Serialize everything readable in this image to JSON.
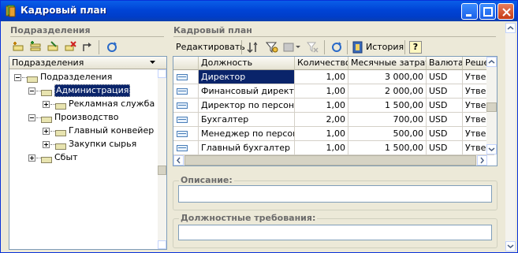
{
  "window": {
    "title": "Кадровый план"
  },
  "left": {
    "section_title": "Подразделения",
    "tree_header": "Подразделения",
    "tree": [
      {
        "label": "Подразделения",
        "level": 0,
        "expanded": true,
        "selected": false
      },
      {
        "label": "Администрация",
        "level": 1,
        "expanded": true,
        "selected": true
      },
      {
        "label": "Рекламная служба",
        "level": 2,
        "expanded": false,
        "selected": false
      },
      {
        "label": "Производство",
        "level": 1,
        "expanded": true,
        "selected": false
      },
      {
        "label": "Главный конвейер",
        "level": 2,
        "expanded": false,
        "selected": false
      },
      {
        "label": "Закупки сырья",
        "level": 2,
        "expanded": false,
        "selected": false
      },
      {
        "label": "Сбыт",
        "level": 1,
        "expanded": false,
        "selected": false
      }
    ]
  },
  "right": {
    "section_title": "Кадровый план",
    "toolbar": {
      "edit_label": "Редактировать",
      "history_label": "История",
      "help_label": "?"
    },
    "columns": [
      "Должность",
      "Количество",
      "Месячные затраты",
      "Валюта",
      "Решен"
    ],
    "rows": [
      {
        "position": "Директор",
        "count": "1,00",
        "cost": "3 000,00",
        "currency": "USD",
        "decision": "Утве",
        "selected": true
      },
      {
        "position": "Финансовый директор",
        "count": "1,00",
        "cost": "2 000,00",
        "currency": "USD",
        "decision": "Утве",
        "selected": false
      },
      {
        "position": "Директор по персон...",
        "count": "1,00",
        "cost": "1 500,00",
        "currency": "USD",
        "decision": "Утве",
        "selected": false
      },
      {
        "position": "Бухгалтер",
        "count": "2,00",
        "cost": "700,00",
        "currency": "USD",
        "decision": "Утве",
        "selected": false
      },
      {
        "position": "Менеджер по персон...",
        "count": "1,00",
        "cost": "500,00",
        "currency": "USD",
        "decision": "Утве",
        "selected": false
      },
      {
        "position": "Главный бухгалтер",
        "count": "1,00",
        "cost": "1 500,00",
        "currency": "USD",
        "decision": "Утве",
        "selected": false
      }
    ],
    "description_label": "Описание:",
    "requirements_label": "Должностные требования:"
  },
  "colors": {
    "titlebar": "#0044d6",
    "selection": "#0a246a",
    "window_bg": "#ece9d8"
  }
}
